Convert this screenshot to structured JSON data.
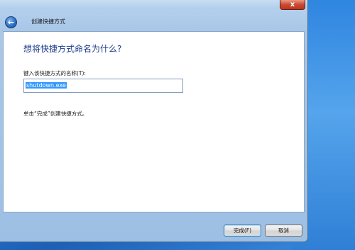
{
  "window": {
    "title": "创建快捷方式",
    "close_label": "x",
    "back_label": "←"
  },
  "main": {
    "heading": "想将快捷方式命名为什么?",
    "field_label": "键入该快捷方式的名称(T):",
    "name_value": "shutdown.exe",
    "instruction": "单击“完成”创建快捷方式。"
  },
  "footer": {
    "finish_label": "完成(F)",
    "cancel_label": "取消"
  }
}
